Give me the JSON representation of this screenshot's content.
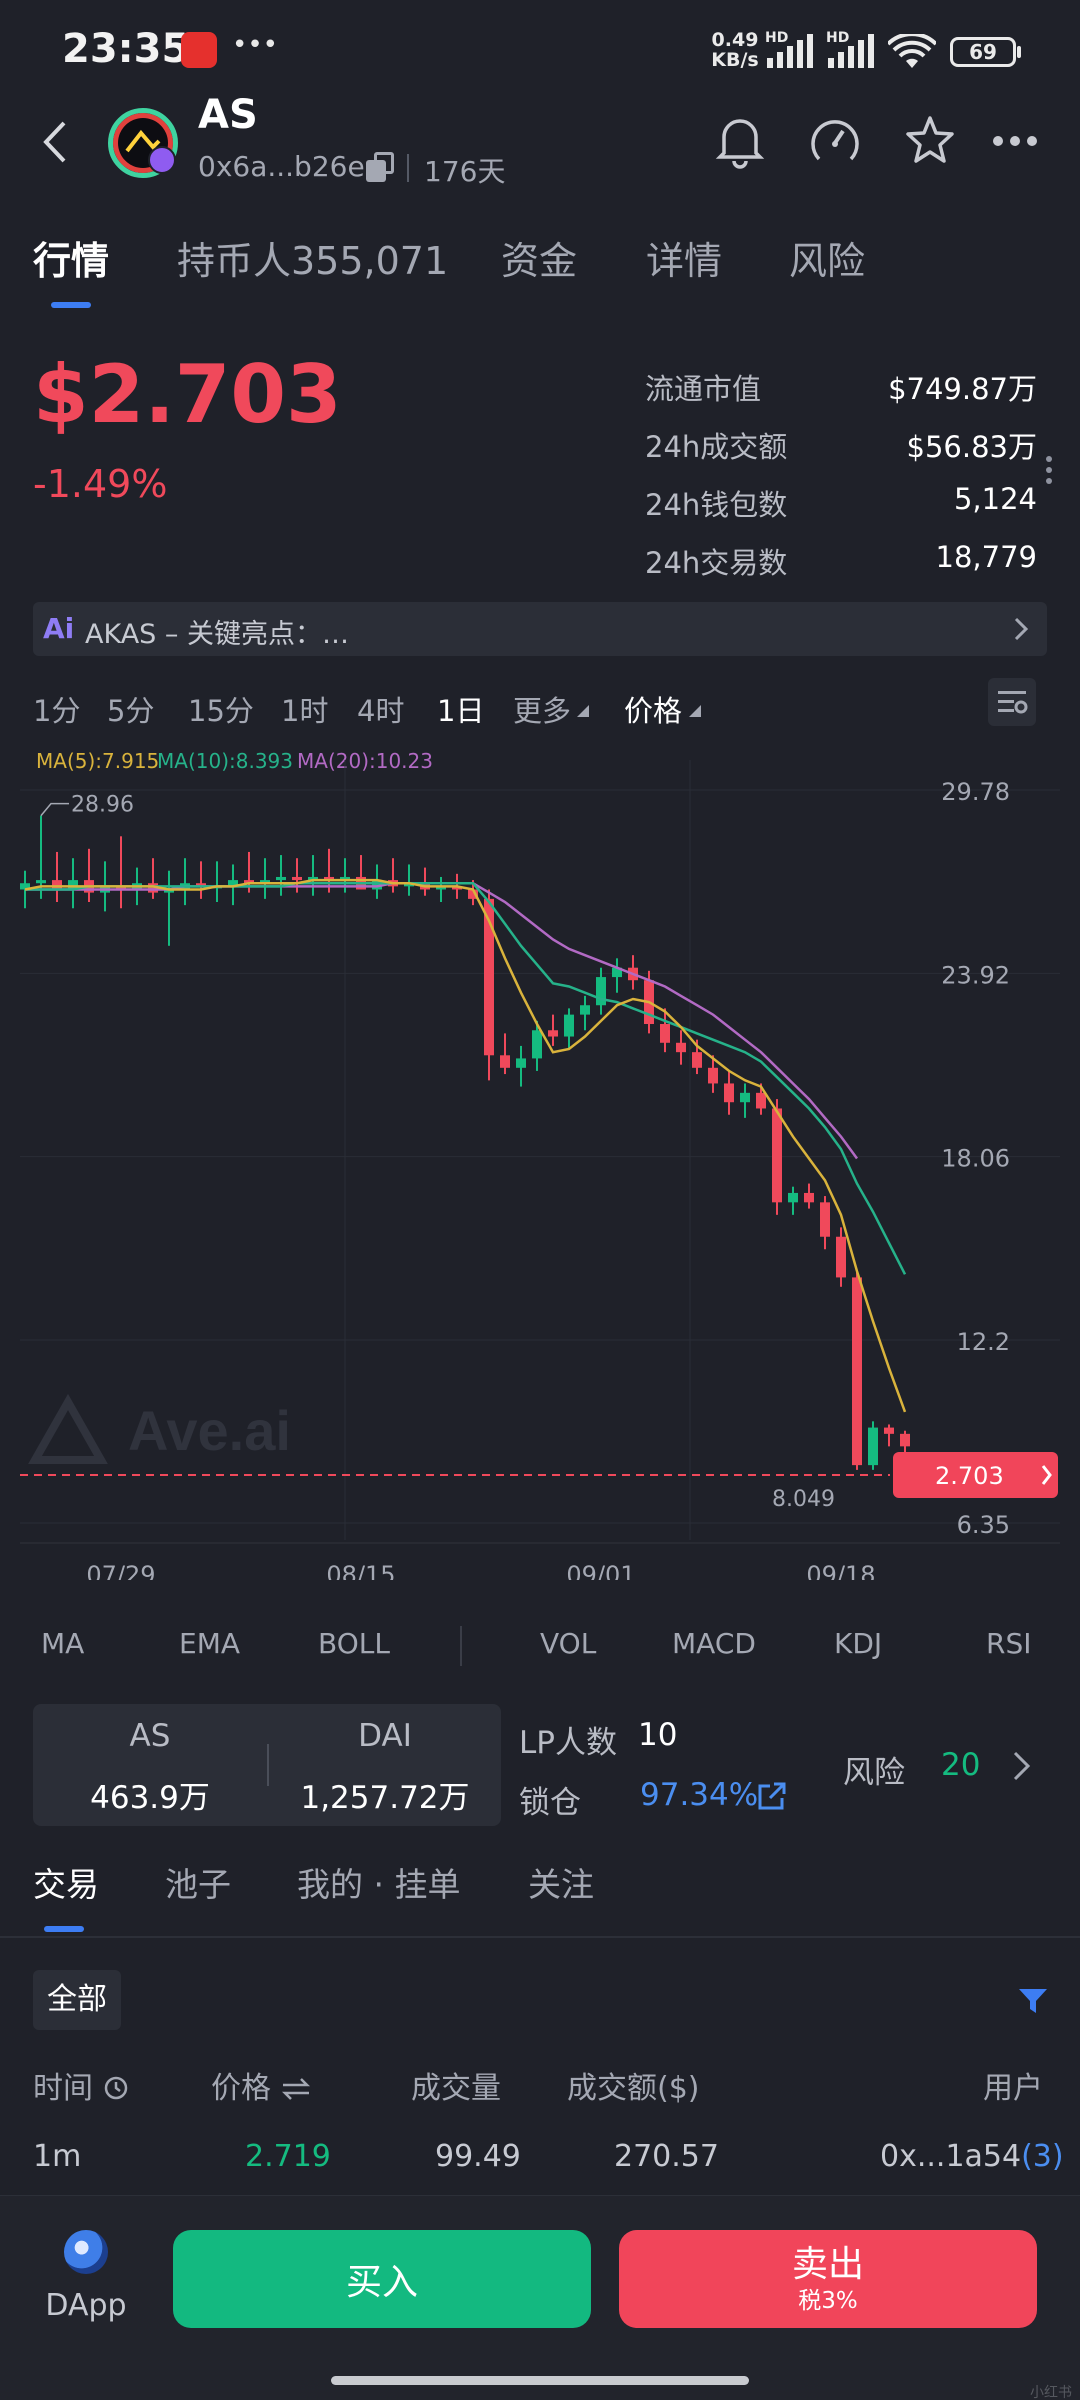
{
  "status": {
    "time": "23:35",
    "dots": "•••",
    "net_speed_top": "0.49",
    "net_speed_bottom": "KB/s",
    "hd1": "HD",
    "hd2": "HD",
    "battery": "69"
  },
  "header": {
    "token_symbol": "AS",
    "address": "0x6a...b26e",
    "age": "176天"
  },
  "tabs": [
    "行情",
    "持币人355,071",
    "资金",
    "详情",
    "风险"
  ],
  "price": {
    "value": "$2.703",
    "change": "-1.49%"
  },
  "stats": [
    {
      "label": "流通市值",
      "value": "$749.87万"
    },
    {
      "label": "24h成交额",
      "value": "$56.83万"
    },
    {
      "label": "24h钱包数",
      "value": "5,124"
    },
    {
      "label": "24h交易数",
      "value": "18,779"
    }
  ],
  "ai_bar": {
    "badge": "Ai",
    "text": "AKAS – 关键亮点：…"
  },
  "timeframes": [
    "1分",
    "5分",
    "15分",
    "1时",
    "4时",
    "1日",
    "更多",
    "价格"
  ],
  "timeframe_active": "1日",
  "ma_legend": {
    "ma5": "MA(5):7.915",
    "ma10": "MA(10):8.393",
    "ma20": "MA(20):10.23"
  },
  "chart_data": {
    "type": "candlestick",
    "x_ticks": [
      "07/29",
      "08/15",
      "09/01",
      "09/18"
    ],
    "y_ticks": [
      29.78,
      23.92,
      18.06,
      12.2,
      6.35
    ],
    "ylim": [
      6.35,
      29.78
    ],
    "high_label": "28.96",
    "low_label": "8.049",
    "current_price_label": "2.703",
    "watermark": "Ave.ai",
    "colors": {
      "up": "#15bb80",
      "down": "#f0495b",
      "ma5": "#d9b33c",
      "ma10": "#26b28a",
      "ma20": "#b26ac4"
    },
    "candles": [
      [
        26.6,
        27.2,
        26.0,
        26.8
      ],
      [
        26.8,
        28.96,
        26.3,
        26.9
      ],
      [
        26.9,
        27.8,
        26.2,
        26.6
      ],
      [
        26.6,
        27.6,
        26.0,
        26.9
      ],
      [
        26.9,
        27.9,
        26.2,
        26.5
      ],
      [
        26.5,
        27.5,
        25.9,
        26.7
      ],
      [
        26.7,
        28.3,
        26.0,
        26.6
      ],
      [
        26.6,
        27.3,
        26.1,
        26.8
      ],
      [
        26.8,
        27.6,
        26.3,
        26.5
      ],
      [
        26.5,
        27.2,
        24.8,
        26.6
      ],
      [
        26.6,
        27.6,
        26.1,
        26.8
      ],
      [
        26.8,
        27.5,
        26.3,
        26.7
      ],
      [
        26.7,
        27.5,
        26.2,
        26.7
      ],
      [
        26.7,
        27.4,
        26.1,
        26.9
      ],
      [
        26.9,
        27.8,
        26.5,
        26.8
      ],
      [
        26.8,
        27.6,
        26.3,
        26.9
      ],
      [
        26.9,
        27.7,
        26.4,
        27.0
      ],
      [
        27.0,
        27.6,
        26.5,
        26.9
      ],
      [
        26.9,
        27.7,
        26.4,
        27.0
      ],
      [
        27.0,
        27.9,
        26.5,
        26.9
      ],
      [
        26.9,
        27.6,
        26.5,
        27.0
      ],
      [
        27.0,
        27.7,
        26.6,
        26.6
      ],
      [
        26.6,
        27.4,
        26.3,
        26.9
      ],
      [
        26.9,
        27.6,
        26.5,
        26.7
      ],
      [
        26.7,
        27.4,
        26.4,
        26.8
      ],
      [
        26.8,
        27.3,
        26.4,
        26.6
      ],
      [
        26.6,
        27.0,
        26.2,
        26.7
      ],
      [
        26.7,
        27.1,
        26.3,
        26.6
      ],
      [
        26.6,
        26.9,
        26.1,
        26.3
      ],
      [
        26.3,
        26.6,
        20.5,
        21.3
      ],
      [
        21.3,
        22.0,
        20.7,
        20.9
      ],
      [
        20.9,
        21.6,
        20.3,
        21.2
      ],
      [
        21.2,
        22.4,
        20.8,
        22.1
      ],
      [
        22.1,
        22.6,
        21.6,
        21.9
      ],
      [
        21.9,
        22.8,
        21.5,
        22.6
      ],
      [
        22.6,
        23.2,
        22.1,
        22.9
      ],
      [
        22.9,
        24.1,
        22.6,
        23.8
      ],
      [
        23.8,
        24.4,
        23.3,
        24.1
      ],
      [
        24.1,
        24.5,
        23.4,
        23.7
      ],
      [
        23.7,
        24.0,
        22.0,
        22.3
      ],
      [
        22.3,
        22.8,
        21.4,
        21.7
      ],
      [
        21.7,
        22.1,
        21.0,
        21.4
      ],
      [
        21.4,
        21.8,
        20.7,
        20.9
      ],
      [
        20.9,
        21.3,
        20.1,
        20.4
      ],
      [
        20.4,
        20.8,
        19.4,
        19.8
      ],
      [
        19.8,
        20.4,
        19.3,
        20.1
      ],
      [
        20.1,
        20.4,
        19.4,
        19.6
      ],
      [
        19.6,
        19.9,
        16.2,
        16.6
      ],
      [
        16.6,
        17.1,
        16.2,
        16.9
      ],
      [
        16.9,
        17.2,
        16.4,
        16.6
      ],
      [
        16.6,
        16.8,
        15.1,
        15.5
      ],
      [
        15.5,
        15.8,
        13.9,
        14.2
      ],
      [
        14.2,
        14.4,
        8.049,
        8.2
      ],
      [
        8.2,
        9.6,
        8.049,
        9.4
      ],
      [
        9.4,
        9.5,
        8.8,
        9.2
      ],
      [
        9.2,
        9.3,
        8.6,
        8.8
      ]
    ],
    "ma5": [
      26.6,
      26.7,
      26.7,
      26.7,
      26.7,
      26.7,
      26.7,
      26.7,
      26.7,
      26.6,
      26.6,
      26.6,
      26.7,
      26.7,
      26.8,
      26.8,
      26.8,
      26.8,
      26.9,
      26.9,
      26.9,
      26.9,
      26.9,
      26.8,
      26.8,
      26.7,
      26.7,
      26.7,
      26.6,
      25.6,
      24.4,
      23.3,
      22.3,
      21.4,
      21.5,
      21.9,
      22.4,
      22.9,
      23.1,
      23.0,
      22.7,
      22.2,
      21.6,
      21.2,
      20.8,
      20.5,
      20.3,
      19.5,
      18.7,
      18.0,
      17.3,
      16.2,
      14.4,
      12.8,
      11.3,
      9.9
    ],
    "ma10": [
      26.6,
      26.6,
      26.6,
      26.6,
      26.7,
      26.7,
      26.7,
      26.7,
      26.7,
      26.7,
      26.7,
      26.7,
      26.7,
      26.7,
      26.7,
      26.7,
      26.7,
      26.8,
      26.8,
      26.8,
      26.8,
      26.8,
      26.8,
      26.8,
      26.8,
      26.8,
      26.8,
      26.8,
      26.8,
      26.2,
      25.5,
      24.8,
      24.2,
      23.6,
      23.5,
      23.3,
      23.1,
      23.0,
      22.8,
      22.6,
      22.4,
      22.2,
      22.0,
      21.8,
      21.6,
      21.4,
      21.1,
      20.6,
      20.1,
      19.6,
      19.0,
      18.3,
      17.2,
      16.3,
      15.3,
      14.3
    ],
    "ma20": [
      26.6,
      26.6,
      26.6,
      26.6,
      26.6,
      26.6,
      26.6,
      26.6,
      26.6,
      26.6,
      26.7,
      26.7,
      26.7,
      26.7,
      26.7,
      26.7,
      26.7,
      26.7,
      26.7,
      26.7,
      26.7,
      26.7,
      26.7,
      26.8,
      26.8,
      26.8,
      26.8,
      26.8,
      26.8,
      26.5,
      26.2,
      25.8,
      25.4,
      25.0,
      24.7,
      24.5,
      24.3,
      24.1,
      23.9,
      23.7,
      23.5,
      23.2,
      22.9,
      22.6,
      22.2,
      21.8,
      21.4,
      20.9,
      20.4,
      19.9,
      19.3,
      18.7,
      18.0
    ]
  },
  "indicators": [
    "MA",
    "EMA",
    "BOLL",
    "VOL",
    "MACD",
    "KDJ",
    "RSI"
  ],
  "pool": {
    "token_a_name": "AS",
    "token_a_amount": "463.9万",
    "token_b_name": "DAI",
    "token_b_amount": "1,257.72万",
    "lp_label": "LP人数",
    "lp_count": "10",
    "lock_label": "锁仓",
    "lock_value": "97.34%",
    "risk_label": "风险",
    "risk_value": "20"
  },
  "sub_tabs": [
    "交易",
    "池子",
    "我的 · 挂单",
    "关注"
  ],
  "filter_label": "全部",
  "table": {
    "headers": [
      "时间",
      "价格",
      "成交量",
      "成交额($)",
      "用户"
    ],
    "rows": [
      {
        "time": "1m",
        "price": "2.719",
        "volume": "99.49",
        "amount": "270.57",
        "user": "0x...1a54",
        "user_count": "(3)"
      }
    ]
  },
  "bottom": {
    "dapp": "DApp",
    "buy": "买入",
    "sell": "卖出",
    "sell_tax": "税3%"
  },
  "watermark_corner": "小红书"
}
